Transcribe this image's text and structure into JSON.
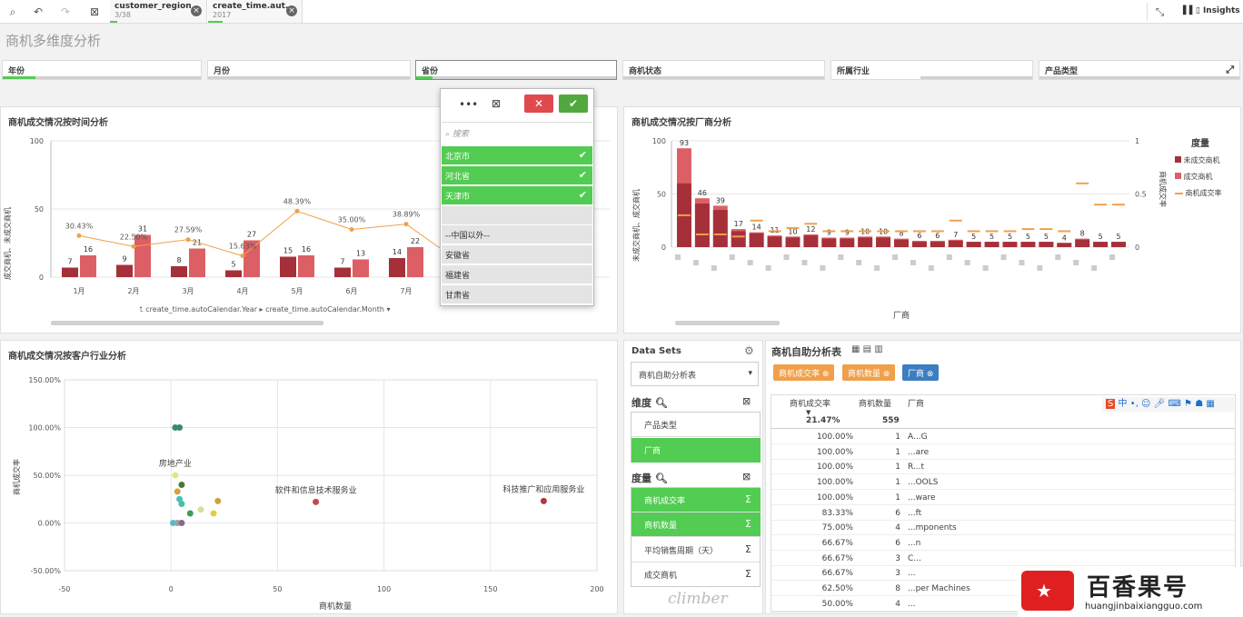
{
  "toolbar": {
    "insights_label": "Insights",
    "selection_tabs": [
      {
        "field": "customer_region",
        "value": "3/38"
      },
      {
        "field": "create_time.aut...",
        "value": "2017"
      }
    ]
  },
  "sheet": {
    "title": "商机多维度分析"
  },
  "filters": [
    "年份",
    "月份",
    "省份",
    "商机状态",
    "所属行业",
    "产品类型"
  ],
  "dropdown": {
    "search_placeholder": "搜索",
    "selected": [
      "北京市",
      "河北省",
      "天津市"
    ],
    "others": [
      "--中国以外--",
      "安徽省",
      "福建省",
      "甘肃省"
    ]
  },
  "time_chart": {
    "title": "商机成交情况按时间分析",
    "ylabel": "成交商机、未成交商机",
    "dim_path": [
      "create_time.autoCalendar.Year",
      "create_time.autoCalendar.Month"
    ]
  },
  "vendor_chart": {
    "title": "商机成交情况按厂商分析",
    "ylabel_left": "未成交商机、成交商机",
    "ylabel_right": "商机成交率",
    "xlabel": "厂商",
    "legend_title": "度量",
    "legend": [
      "未成交商机",
      "成交商机",
      "商机成交率"
    ]
  },
  "scatter_chart": {
    "title": "商机成交情况按客户行业分析",
    "xlabel": "商机数量",
    "ylabel": "商机成交率"
  },
  "datasets": {
    "label": "Data Sets",
    "current": "商机自助分析表",
    "dims_label": "维度",
    "dims": [
      "产品类型",
      "厂商"
    ],
    "measures_label": "度量",
    "measures": [
      "商机成交率",
      "商机数量",
      "平均销售周期（天）",
      "成交商机"
    ],
    "logo": "climber"
  },
  "table": {
    "title": "商机自助分析表",
    "chips": [
      "商机成交率",
      "商机数量",
      "厂商"
    ],
    "headers": [
      "商机成交率",
      "商机数量",
      "厂商"
    ],
    "totals": [
      "21.47%",
      "559",
      ""
    ],
    "rows": [
      [
        "100.00%",
        "1",
        "A...G"
      ],
      [
        "100.00%",
        "1",
        "...are"
      ],
      [
        "100.00%",
        "1",
        "R...t"
      ],
      [
        "100.00%",
        "1",
        "...OOLS"
      ],
      [
        "100.00%",
        "1",
        "...ware"
      ],
      [
        "83.33%",
        "6",
        "...ft"
      ],
      [
        "75.00%",
        "4",
        "...mponents"
      ],
      [
        "66.67%",
        "6",
        "...n"
      ],
      [
        "66.67%",
        "3",
        "C..."
      ],
      [
        "66.67%",
        "3",
        "..."
      ],
      [
        "62.50%",
        "8",
        "...per Machines"
      ],
      [
        "50.00%",
        "4",
        "..."
      ]
    ]
  },
  "watermark": {
    "name": "百香果号",
    "url": "huangjinbaixiangguo.com"
  },
  "chart_data": [
    {
      "type": "bar",
      "title": "商机成交情况按时间分析",
      "categories": [
        "1月",
        "2月",
        "3月",
        "4月",
        "5月",
        "6月",
        "7月"
      ],
      "series": [
        {
          "name": "未成交商机",
          "values": [
            7,
            9,
            8,
            5,
            15,
            7,
            14
          ]
        },
        {
          "name": "成交商机",
          "values": [
            16,
            31,
            21,
            27,
            16,
            13,
            22
          ]
        },
        {
          "name": "商机成交率",
          "values": [
            30.43,
            22.5,
            27.59,
            15.63,
            48.39,
            35.0,
            38.89
          ]
        }
      ],
      "ylim": [
        0,
        100
      ],
      "yticks": [
        0,
        50,
        100
      ],
      "rate_labels": [
        "30.43%",
        "22.50%",
        "27.59%",
        "15.63%",
        "48.39%",
        "35.00%",
        "38.89%"
      ]
    },
    {
      "type": "bar",
      "title": "商机成交情况按厂商分析",
      "series": [
        {
          "name": "未成交商机",
          "values": [
            60,
            46,
            39,
            17,
            14,
            11,
            10,
            12,
            9,
            9,
            10,
            10,
            8,
            6,
            6,
            7,
            5,
            5,
            5,
            5,
            5,
            4,
            8,
            5,
            5
          ]
        },
        {
          "name": "成交商机",
          "values": [
            93,
            46,
            39,
            17,
            14,
            11,
            10,
            12,
            9,
            9,
            10,
            10,
            8,
            6,
            6,
            7,
            5,
            5,
            5,
            5,
            5,
            4,
            8,
            5,
            5
          ]
        },
        {
          "name": "商机成交率",
          "values": [
            0.3,
            0.12,
            0.12,
            0.1,
            0.25,
            0.15,
            0.18,
            0.22,
            0.15,
            0.15,
            0.15,
            0.15,
            0.15,
            0.15,
            0.15,
            0.25,
            0.15,
            0.15,
            0.15,
            0.17,
            0.17,
            0.15,
            0.6,
            0.4,
            0.4
          ]
        }
      ],
      "data_labels": [
        "93",
        "46",
        "39",
        "17",
        "14",
        "11",
        "10",
        "12",
        "9",
        "9",
        "10",
        "10",
        "8",
        "6",
        "6",
        "7",
        "5",
        "5",
        "5",
        "5",
        "5",
        "4",
        "8",
        "5",
        "5"
      ],
      "ylim": [
        0,
        100
      ],
      "yticks": [
        0,
        50,
        100
      ],
      "y2ticks": [
        "0",
        "0.5",
        "1"
      ]
    },
    {
      "type": "scatter",
      "title": "商机成交情况按客户行业分析",
      "xlim": [
        -50,
        200
      ],
      "ylim": [
        -50,
        150
      ],
      "xticks": [
        -50,
        0,
        50,
        100,
        150,
        200
      ],
      "yticks": [
        "-50.00%",
        "0.00%",
        "50.00%",
        "100.00%",
        "150.00%"
      ],
      "points": [
        {
          "x": 2,
          "y": 100,
          "label": ""
        },
        {
          "x": 4,
          "y": 100,
          "label": ""
        },
        {
          "x": 2,
          "y": 50,
          "label": "房地产业"
        },
        {
          "x": 5,
          "y": 40,
          "label": ""
        },
        {
          "x": 3,
          "y": 33,
          "label": ""
        },
        {
          "x": 4,
          "y": 25,
          "label": ""
        },
        {
          "x": 5,
          "y": 20,
          "label": ""
        },
        {
          "x": 9,
          "y": 10,
          "label": ""
        },
        {
          "x": 14,
          "y": 14,
          "label": ""
        },
        {
          "x": 20,
          "y": 10,
          "label": ""
        },
        {
          "x": 22,
          "y": 23,
          "label": ""
        },
        {
          "x": 1,
          "y": 0,
          "label": ""
        },
        {
          "x": 3,
          "y": 0,
          "label": ""
        },
        {
          "x": 5,
          "y": 0,
          "label": ""
        },
        {
          "x": 68,
          "y": 22,
          "label": "软件和信息技术服务业"
        },
        {
          "x": 175,
          "y": 23,
          "label": "科技推广和应用服务业"
        }
      ]
    }
  ]
}
